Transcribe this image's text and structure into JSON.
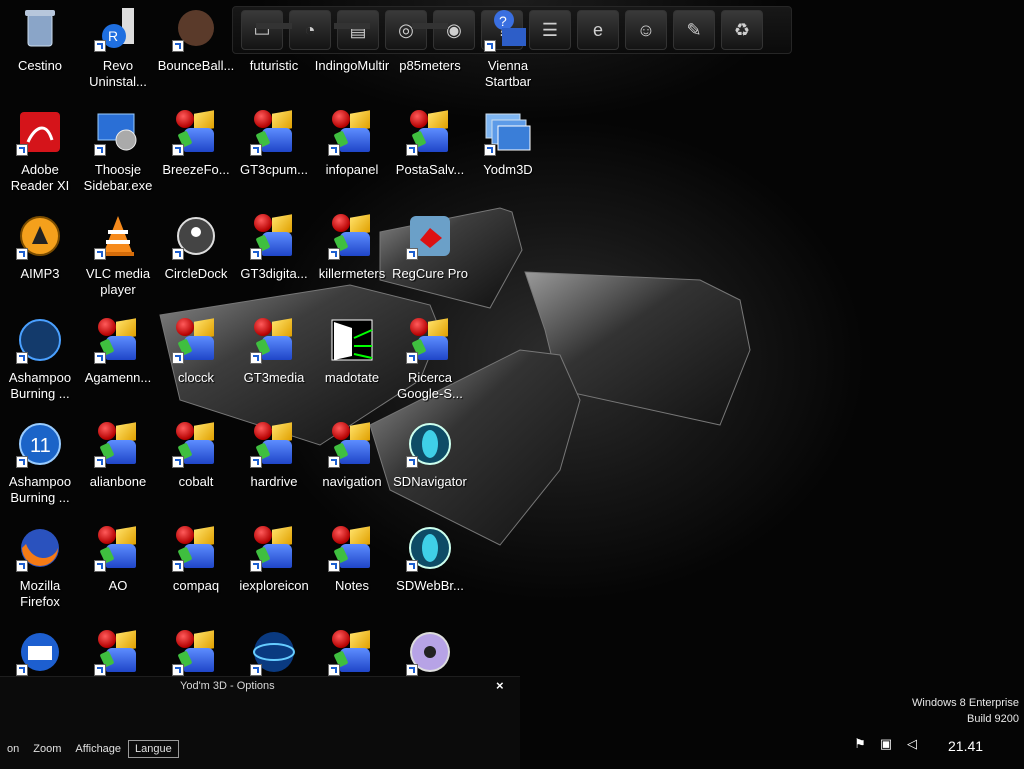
{
  "desktop": {
    "icons": [
      {
        "label": "Cestino",
        "kind": "recycle-bin-icon",
        "col": 0,
        "row": 0,
        "shortcut": false
      },
      {
        "label": "Revo\nUninstal...",
        "kind": "revo-uninstaller-icon",
        "col": 1,
        "row": 0,
        "shortcut": true
      },
      {
        "label": "BounceBall...",
        "kind": "bounceball-icon",
        "col": 2,
        "row": 0,
        "shortcut": true
      },
      {
        "label": "futuristic",
        "kind": "futuristic-icon",
        "col": 3,
        "row": 0,
        "shortcut": false
      },
      {
        "label": "IndingoMultir",
        "kind": "indingo-icon",
        "col": 4,
        "row": 0,
        "shortcut": false
      },
      {
        "label": "p85meters",
        "kind": "meters-icon",
        "col": 5,
        "row": 0,
        "shortcut": false
      },
      {
        "label": "Vienna\nStartbar",
        "kind": "vienna-startbar-icon",
        "col": 6,
        "row": 0,
        "shortcut": true
      },
      {
        "label": "Adobe\nReader XI",
        "kind": "adobe-reader-icon",
        "col": 0,
        "row": 1,
        "shortcut": true
      },
      {
        "label": "Thoosje\nSidebar.exe",
        "kind": "thoosje-sidebar-icon",
        "col": 1,
        "row": 1,
        "shortcut": true
      },
      {
        "label": "BreezeFo...",
        "kind": "generic-app-icon",
        "col": 2,
        "row": 1,
        "shortcut": true
      },
      {
        "label": "GT3cpum...",
        "kind": "generic-app-icon",
        "col": 3,
        "row": 1,
        "shortcut": true
      },
      {
        "label": "infopanel",
        "kind": "generic-app-icon",
        "col": 4,
        "row": 1,
        "shortcut": true
      },
      {
        "label": "PostaSalv...",
        "kind": "generic-app-icon",
        "col": 5,
        "row": 1,
        "shortcut": true
      },
      {
        "label": "Yodm3D",
        "kind": "yodm3d-icon",
        "col": 6,
        "row": 1,
        "shortcut": true
      },
      {
        "label": "AIMP3",
        "kind": "aimp3-icon",
        "col": 0,
        "row": 2,
        "shortcut": true
      },
      {
        "label": "VLC media\nplayer",
        "kind": "vlc-icon",
        "col": 1,
        "row": 2,
        "shortcut": true
      },
      {
        "label": "CircleDock",
        "kind": "circledock-icon",
        "col": 2,
        "row": 2,
        "shortcut": true
      },
      {
        "label": "GT3digita...",
        "kind": "generic-app-icon",
        "col": 3,
        "row": 2,
        "shortcut": true
      },
      {
        "label": "killermeters",
        "kind": "generic-app-icon",
        "col": 4,
        "row": 2,
        "shortcut": true
      },
      {
        "label": "RegCure Pro",
        "kind": "regcure-icon",
        "col": 5,
        "row": 2,
        "shortcut": true
      },
      {
        "label": "Ashampoo\nBurning ...",
        "kind": "ashampoo-compact-icon",
        "col": 0,
        "row": 3,
        "shortcut": true
      },
      {
        "label": "Agamenn...",
        "kind": "generic-app-icon",
        "col": 1,
        "row": 3,
        "shortcut": true
      },
      {
        "label": "clocck",
        "kind": "generic-app-icon",
        "col": 2,
        "row": 3,
        "shortcut": true
      },
      {
        "label": "GT3media",
        "kind": "generic-app-icon",
        "col": 3,
        "row": 3,
        "shortcut": true
      },
      {
        "label": "madotate",
        "kind": "madotate-icon",
        "col": 4,
        "row": 3,
        "shortcut": false
      },
      {
        "label": "Ricerca\nGoogle-S...",
        "kind": "generic-app-icon",
        "col": 5,
        "row": 3,
        "shortcut": true
      },
      {
        "label": "Ashampoo\nBurning ...",
        "kind": "ashampoo-11-icon",
        "col": 0,
        "row": 4,
        "shortcut": true
      },
      {
        "label": "alianbone",
        "kind": "generic-app-icon",
        "col": 1,
        "row": 4,
        "shortcut": true
      },
      {
        "label": "cobalt",
        "kind": "generic-app-icon",
        "col": 2,
        "row": 4,
        "shortcut": true
      },
      {
        "label": "hardrive",
        "kind": "generic-app-icon",
        "col": 3,
        "row": 4,
        "shortcut": true
      },
      {
        "label": "navigation",
        "kind": "generic-app-icon",
        "col": 4,
        "row": 4,
        "shortcut": true
      },
      {
        "label": "SDNavigator",
        "kind": "sdnavigator-icon",
        "col": 5,
        "row": 4,
        "shortcut": true
      },
      {
        "label": "Mozilla\nFirefox",
        "kind": "firefox-icon",
        "col": 0,
        "row": 5,
        "shortcut": true
      },
      {
        "label": "AO",
        "kind": "generic-app-icon",
        "col": 1,
        "row": 5,
        "shortcut": true
      },
      {
        "label": "compaq",
        "kind": "generic-app-icon",
        "col": 2,
        "row": 5,
        "shortcut": true
      },
      {
        "label": "iexploreicon",
        "kind": "generic-app-icon",
        "col": 3,
        "row": 5,
        "shortcut": true
      },
      {
        "label": "Notes",
        "kind": "generic-app-icon",
        "col": 4,
        "row": 5,
        "shortcut": true
      },
      {
        "label": "SDWebBr...",
        "kind": "sdwebbrowser-icon",
        "col": 5,
        "row": 5,
        "shortcut": true
      },
      {
        "label": "",
        "kind": "thunderbird-icon",
        "col": 0,
        "row": 6,
        "shortcut": true
      },
      {
        "label": "",
        "kind": "generic-app-icon",
        "col": 1,
        "row": 6,
        "shortcut": true
      },
      {
        "label": "",
        "kind": "generic-app-icon",
        "col": 2,
        "row": 6,
        "shortcut": true
      },
      {
        "label": "",
        "kind": "globe-icon",
        "col": 3,
        "row": 6,
        "shortcut": true
      },
      {
        "label": "",
        "kind": "generic-app-icon",
        "col": 4,
        "row": 6,
        "shortcut": true
      },
      {
        "label": "",
        "kind": "disc-icon",
        "col": 5,
        "row": 6,
        "shortcut": true
      }
    ]
  },
  "dock": {
    "items": [
      {
        "name": "monitor-icon",
        "glyph": "▭"
      },
      {
        "name": "gauge-icon",
        "glyph": "◔"
      },
      {
        "name": "folder-icon",
        "glyph": "▤"
      },
      {
        "name": "speaker-icon",
        "glyph": "◎"
      },
      {
        "name": "camera-icon",
        "glyph": "◉"
      },
      {
        "name": "help-icon",
        "glyph": "?"
      },
      {
        "name": "mixer-icon",
        "glyph": "☰"
      },
      {
        "name": "internet-explorer-icon",
        "glyph": "e"
      },
      {
        "name": "user-icon",
        "glyph": "☺"
      },
      {
        "name": "tools-icon",
        "glyph": "✎"
      },
      {
        "name": "recycle-icon",
        "glyph": "♻"
      }
    ]
  },
  "options_panel": {
    "title": "Yod'm 3D - Options",
    "close_label": "×",
    "tabs": [
      {
        "label": "on",
        "active": false
      },
      {
        "label": "Zoom",
        "active": false
      },
      {
        "label": "Affichage",
        "active": false
      },
      {
        "label": "Langue",
        "active": true
      }
    ]
  },
  "watermark": {
    "line1": "Windows 8 Enterprise",
    "line2": "Build 9200"
  },
  "tray": {
    "clock": "21.41"
  }
}
